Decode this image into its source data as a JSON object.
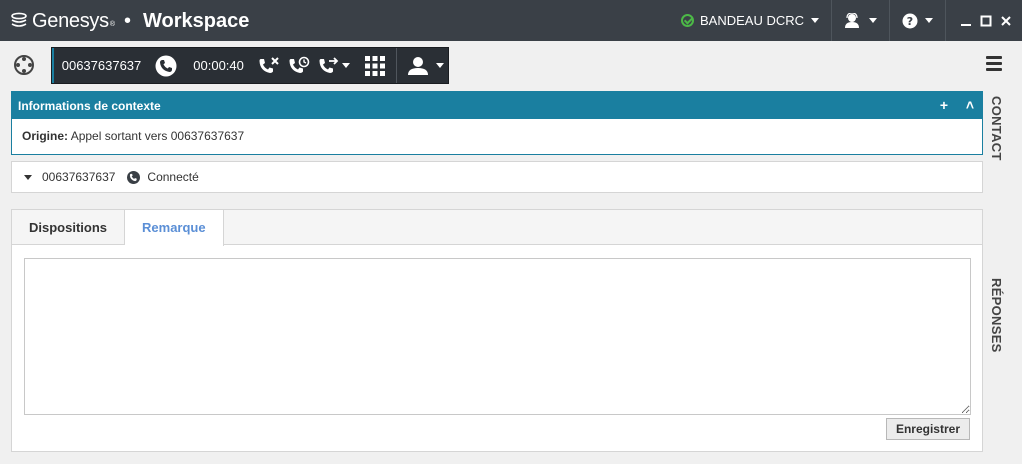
{
  "titlebar": {
    "brand": "Genesys",
    "brand_mark": "®",
    "separator": "•",
    "product": "Workspace",
    "status_label": "BANDEAU DCRC",
    "status_color": "#4cb847"
  },
  "callbar": {
    "number": "00637637637",
    "duration": "00:00:40",
    "icons": [
      "phone-icon",
      "end-call-icon",
      "hold-call-icon",
      "transfer-call-icon",
      "keypad-icon",
      "consult-agent-icon"
    ]
  },
  "context": {
    "title": "Informations de contexte",
    "origin_label": "Origine:",
    "origin_value": "Appel sortant vers 00637637637",
    "add_symbol": "+",
    "collapse_symbol": "˄"
  },
  "interaction": {
    "number": "00637637637",
    "state": "Connecté"
  },
  "tabs": [
    {
      "label": "Dispositions",
      "active": false
    },
    {
      "label": "Remarque",
      "active": true
    }
  ],
  "note": {
    "value": "",
    "save_label": "Enregistrer"
  },
  "side_tabs": {
    "contact": "CONTACT",
    "responses": "RÉPONSES"
  },
  "colors": {
    "accent": "#1a7fa0",
    "titlebar_bg": "#3a4047",
    "callbar_bg": "#2a2f35",
    "active_tab": "#5b8fd6"
  }
}
